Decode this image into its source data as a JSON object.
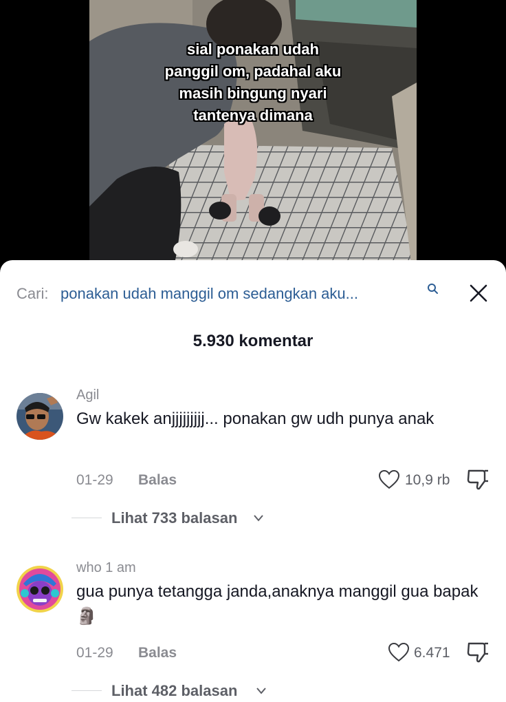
{
  "video": {
    "caption_lines": [
      "sial ponakan udah",
      "panggil om, padahal aku",
      "masih bingung nyari",
      "tantenya dimana"
    ]
  },
  "search": {
    "label": "Cari:",
    "query": "ponakan udah manggil om sedangkan aku...",
    "icon": "search-icon",
    "close_icon": "close-icon"
  },
  "comments_count": "5.930 komentar",
  "comments": [
    {
      "username": "Agil",
      "text": "Gw kakek anjjjjjjjjj... ponakan gw udh punya anak",
      "date": "01-29",
      "reply_label": "Balas",
      "likes": "10,9 rb",
      "view_replies": "Lihat 733 balasan"
    },
    {
      "username": "who 1 am",
      "text": "gua punya tetangga janda,anaknya manggil gua bapak",
      "emoji": "🗿",
      "date": "01-29",
      "reply_label": "Balas",
      "likes": "6.471",
      "view_replies": "Lihat 482 balasan"
    }
  ],
  "colors": {
    "query_link": "#2c5d94",
    "muted": "#8a8b91",
    "text": "#161823"
  }
}
